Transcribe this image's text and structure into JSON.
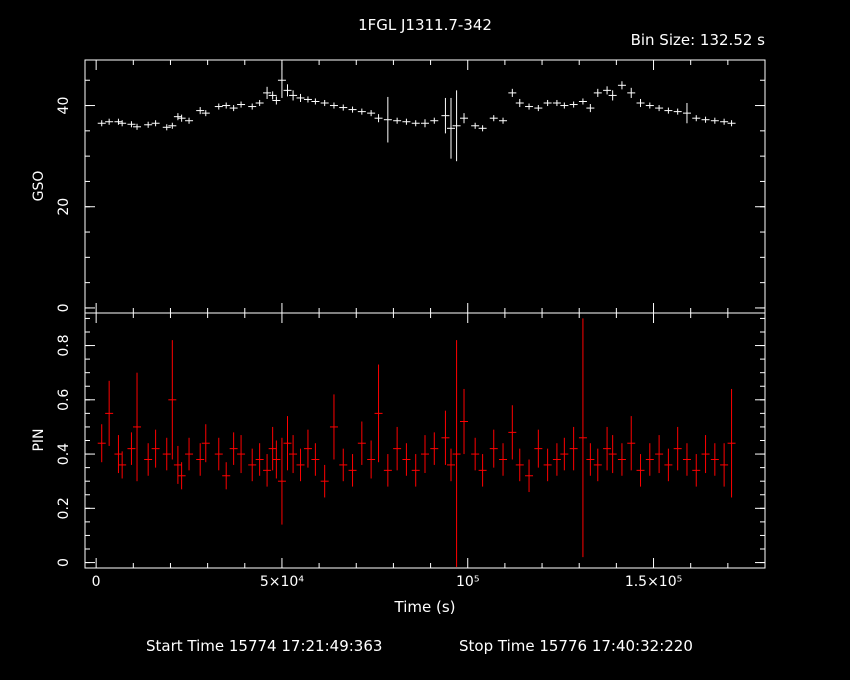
{
  "header": {
    "title": "1FGL J1311.7-342",
    "bin_size": "Bin Size: 132.52 s"
  },
  "footer": {
    "start_time": "Start Time 15774 17:21:49:363",
    "stop_time": "Stop Time 15776 17:40:32:220"
  },
  "colors": {
    "gso": "#ffffff",
    "pin": "#ff0000",
    "axes": "#ffffff",
    "background": "#000000"
  },
  "chart_data": [
    {
      "type": "scatter",
      "panel": "top",
      "title": "1FGL J1311.7-342",
      "ylabel": "GSO",
      "xlabel": "",
      "xlim": [
        -3000,
        180000
      ],
      "ylim": [
        -1,
        49
      ],
      "yticks": [
        0,
        20,
        40
      ],
      "ytick_labels": [
        "0",
        "20",
        "40"
      ],
      "error_bars": true,
      "series": [
        {
          "color": "#ffffff",
          "x": [
            1500,
            3500,
            6000,
            7000,
            9500,
            11000,
            14000,
            16000,
            19000,
            20500,
            22000,
            23000,
            25000,
            28000,
            29500,
            33000,
            35000,
            37000,
            39000,
            42000,
            44000,
            46000,
            47500,
            48500,
            50000,
            51500,
            53000,
            55000,
            57000,
            59000,
            61500,
            64000,
            66500,
            69000,
            71500,
            74000,
            76000,
            78500,
            81000,
            83500,
            86000,
            88500,
            91000,
            94000,
            95500,
            97000,
            99000,
            102000,
            104000,
            107000,
            109500,
            112000,
            114000,
            116500,
            119000,
            121500,
            124000,
            126000,
            128500,
            131000,
            133000,
            135000,
            137500,
            139000,
            141500,
            144000,
            146500,
            149000,
            151500,
            154000,
            156500,
            159000,
            161500,
            164000,
            166500,
            169000,
            171000
          ],
          "y": [
            36.5,
            36.8,
            36.8,
            36.5,
            36.3,
            35.8,
            36.2,
            36.5,
            35.7,
            36.0,
            37.8,
            37.5,
            37.0,
            39.0,
            38.5,
            39.8,
            40.0,
            39.5,
            40.2,
            39.8,
            40.5,
            42.5,
            42.0,
            41.0,
            45.0,
            43.0,
            42.0,
            41.5,
            41.2,
            40.8,
            40.5,
            40.0,
            39.6,
            39.2,
            38.8,
            38.5,
            37.5,
            37.2,
            37.0,
            36.8,
            36.5,
            36.5,
            37.0,
            38.0,
            35.5,
            36.0,
            37.5,
            36.0,
            35.5,
            37.5,
            37.0,
            42.5,
            40.5,
            39.8,
            39.5,
            40.5,
            40.5,
            40.0,
            40.2,
            40.8,
            39.5,
            42.5,
            43.0,
            42.0,
            44.0,
            42.5,
            40.5,
            40.0,
            39.5,
            39.0,
            38.8,
            38.5,
            37.5,
            37.2,
            37.0,
            36.8,
            36.5
          ],
          "err": [
            0.6,
            0.6,
            0.6,
            0.6,
            0.6,
            0.6,
            0.6,
            0.6,
            0.6,
            0.6,
            0.7,
            0.7,
            0.6,
            0.7,
            0.6,
            0.6,
            0.6,
            0.6,
            0.6,
            0.6,
            0.6,
            1.2,
            0.8,
            0.8,
            3.5,
            1.2,
            1.0,
            0.8,
            0.6,
            0.6,
            0.6,
            0.6,
            0.6,
            0.6,
            0.6,
            0.6,
            0.8,
            4.5,
            0.6,
            0.6,
            0.6,
            0.8,
            0.6,
            3.5,
            6.0,
            7.0,
            1.0,
            0.6,
            0.6,
            0.6,
            0.6,
            0.8,
            0.8,
            0.6,
            0.6,
            0.6,
            0.6,
            0.6,
            0.6,
            0.6,
            0.8,
            0.8,
            0.8,
            1.0,
            0.8,
            1.0,
            0.8,
            0.6,
            0.6,
            0.6,
            0.6,
            2.0,
            0.6,
            0.6,
            0.6,
            0.6,
            0.6
          ]
        }
      ]
    },
    {
      "type": "scatter",
      "panel": "bottom",
      "ylabel": "PIN",
      "xlabel": "Time (s)",
      "xlim": [
        -3000,
        180000
      ],
      "ylim": [
        -0.02,
        0.92
      ],
      "yticks": [
        0,
        0.2,
        0.4,
        0.6,
        0.8
      ],
      "ytick_labels": [
        "0",
        "0.2",
        "0.4",
        "0.6",
        "0.8"
      ],
      "xticks": [
        0,
        50000,
        100000,
        150000
      ],
      "xtick_labels": [
        "0",
        "5×10⁴",
        "10⁵",
        "1.5×10⁵"
      ],
      "error_bars": true,
      "series": [
        {
          "color": "#ff0000",
          "x": [
            1500,
            3500,
            6000,
            7000,
            9500,
            11000,
            14000,
            16000,
            19000,
            20500,
            22000,
            23000,
            25000,
            28000,
            29500,
            33000,
            35000,
            37000,
            39000,
            42000,
            44000,
            46000,
            47500,
            48500,
            50000,
            51500,
            53000,
            55000,
            57000,
            59000,
            61500,
            64000,
            66500,
            69000,
            71500,
            74000,
            76000,
            78500,
            81000,
            83500,
            86000,
            88500,
            91000,
            94000,
            95500,
            97000,
            99000,
            102000,
            104000,
            107000,
            109500,
            112000,
            114000,
            116500,
            119000,
            121500,
            124000,
            126000,
            128500,
            131000,
            133000,
            135000,
            137500,
            139000,
            141500,
            144000,
            146500,
            149000,
            151500,
            154000,
            156500,
            159000,
            161500,
            164000,
            166500,
            169000,
            171000
          ],
          "y": [
            0.44,
            0.55,
            0.4,
            0.36,
            0.42,
            0.5,
            0.38,
            0.42,
            0.4,
            0.6,
            0.36,
            0.32,
            0.4,
            0.38,
            0.44,
            0.4,
            0.32,
            0.42,
            0.4,
            0.36,
            0.38,
            0.34,
            0.42,
            0.38,
            0.3,
            0.44,
            0.4,
            0.36,
            0.42,
            0.38,
            0.3,
            0.5,
            0.36,
            0.34,
            0.44,
            0.38,
            0.55,
            0.34,
            0.42,
            0.38,
            0.34,
            0.4,
            0.42,
            0.46,
            0.36,
            0.4,
            0.52,
            0.4,
            0.34,
            0.42,
            0.38,
            0.48,
            0.36,
            0.32,
            0.42,
            0.36,
            0.38,
            0.4,
            0.42,
            0.46,
            0.38,
            0.36,
            0.42,
            0.4,
            0.38,
            0.44,
            0.34,
            0.38,
            0.4,
            0.36,
            0.42,
            0.38,
            0.34,
            0.4,
            0.38,
            0.36,
            0.44
          ],
          "err": [
            0.07,
            0.12,
            0.07,
            0.05,
            0.06,
            0.2,
            0.06,
            0.07,
            0.06,
            0.22,
            0.07,
            0.05,
            0.06,
            0.06,
            0.07,
            0.06,
            0.05,
            0.06,
            0.07,
            0.06,
            0.06,
            0.06,
            0.08,
            0.07,
            0.16,
            0.1,
            0.07,
            0.06,
            0.07,
            0.06,
            0.06,
            0.12,
            0.06,
            0.06,
            0.08,
            0.07,
            0.18,
            0.06,
            0.08,
            0.06,
            0.06,
            0.07,
            0.06,
            0.1,
            0.06,
            0.42,
            0.12,
            0.06,
            0.06,
            0.07,
            0.06,
            0.1,
            0.06,
            0.06,
            0.07,
            0.06,
            0.06,
            0.06,
            0.08,
            0.44,
            0.06,
            0.06,
            0.08,
            0.07,
            0.06,
            0.1,
            0.06,
            0.06,
            0.07,
            0.06,
            0.08,
            0.06,
            0.06,
            0.07,
            0.06,
            0.08,
            0.2
          ]
        }
      ]
    }
  ]
}
